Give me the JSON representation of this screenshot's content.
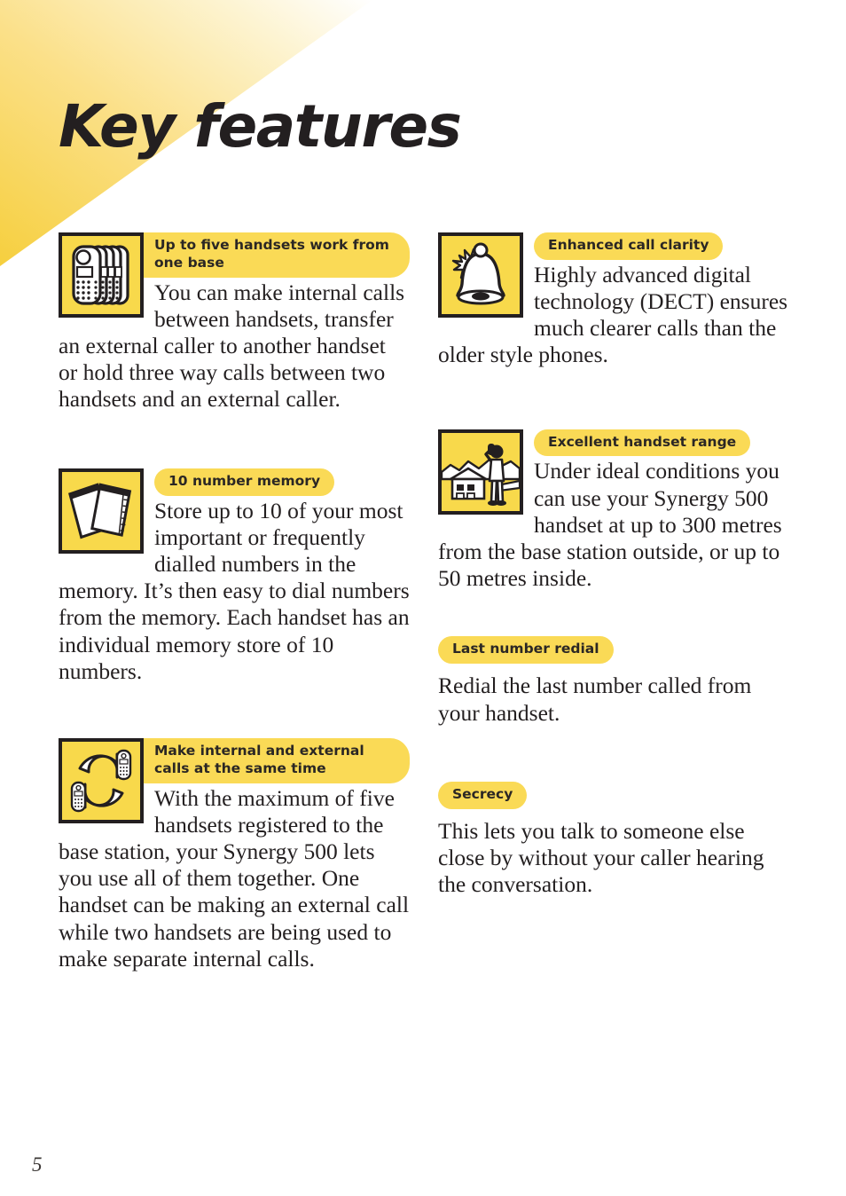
{
  "page": {
    "title": "Key features",
    "number": "5",
    "accent_yellow": "#fada56",
    "icon_yellow": "#f8d94b",
    "ink": "#231f20"
  },
  "columns": {
    "left": [
      {
        "id": "handsets",
        "icon": "stacked-handsets-icon",
        "label": "Up to five handsets work from one base",
        "body": "You can make internal calls between handsets, transfer an external caller to another handset or hold three way calls between two handsets and an external caller."
      },
      {
        "id": "memory",
        "icon": "notepads-icon",
        "label": "10 number memory",
        "body": "Store up to 10 of your most important or frequently dialled numbers in the memory. It’s then easy to dial numbers from the memory. Each handset has an individual memory store of 10 numbers."
      },
      {
        "id": "simultaneous-calls",
        "icon": "circular-arrows-handsets-icon",
        "label": "Make internal and external calls at the same time",
        "body": "With the maximum of five handsets registered to the base station, your Synergy 500 lets you use all of them together. One handset can be making an external call while two handsets are being used to make separate internal calls."
      }
    ],
    "right": [
      {
        "id": "clarity",
        "icon": "ringing-bell-icon",
        "label": "Enhanced call clarity",
        "body": "Highly advanced digital technology (DECT) ensures much clearer calls than the older style phones."
      },
      {
        "id": "range",
        "icon": "person-outdoors-house-icon",
        "label": "Excellent handset range",
        "body": "Under ideal conditions you can use your Synergy 500 handset at up to 300 metres from the base station outside, or up to 50 metres inside."
      },
      {
        "id": "redial",
        "icon": null,
        "label": "Last number redial",
        "body": "Redial the last number called from your handset."
      },
      {
        "id": "secrecy",
        "icon": null,
        "label": "Secrecy",
        "body": "This lets you talk to someone else close by without your caller hearing the conversation."
      }
    ]
  }
}
